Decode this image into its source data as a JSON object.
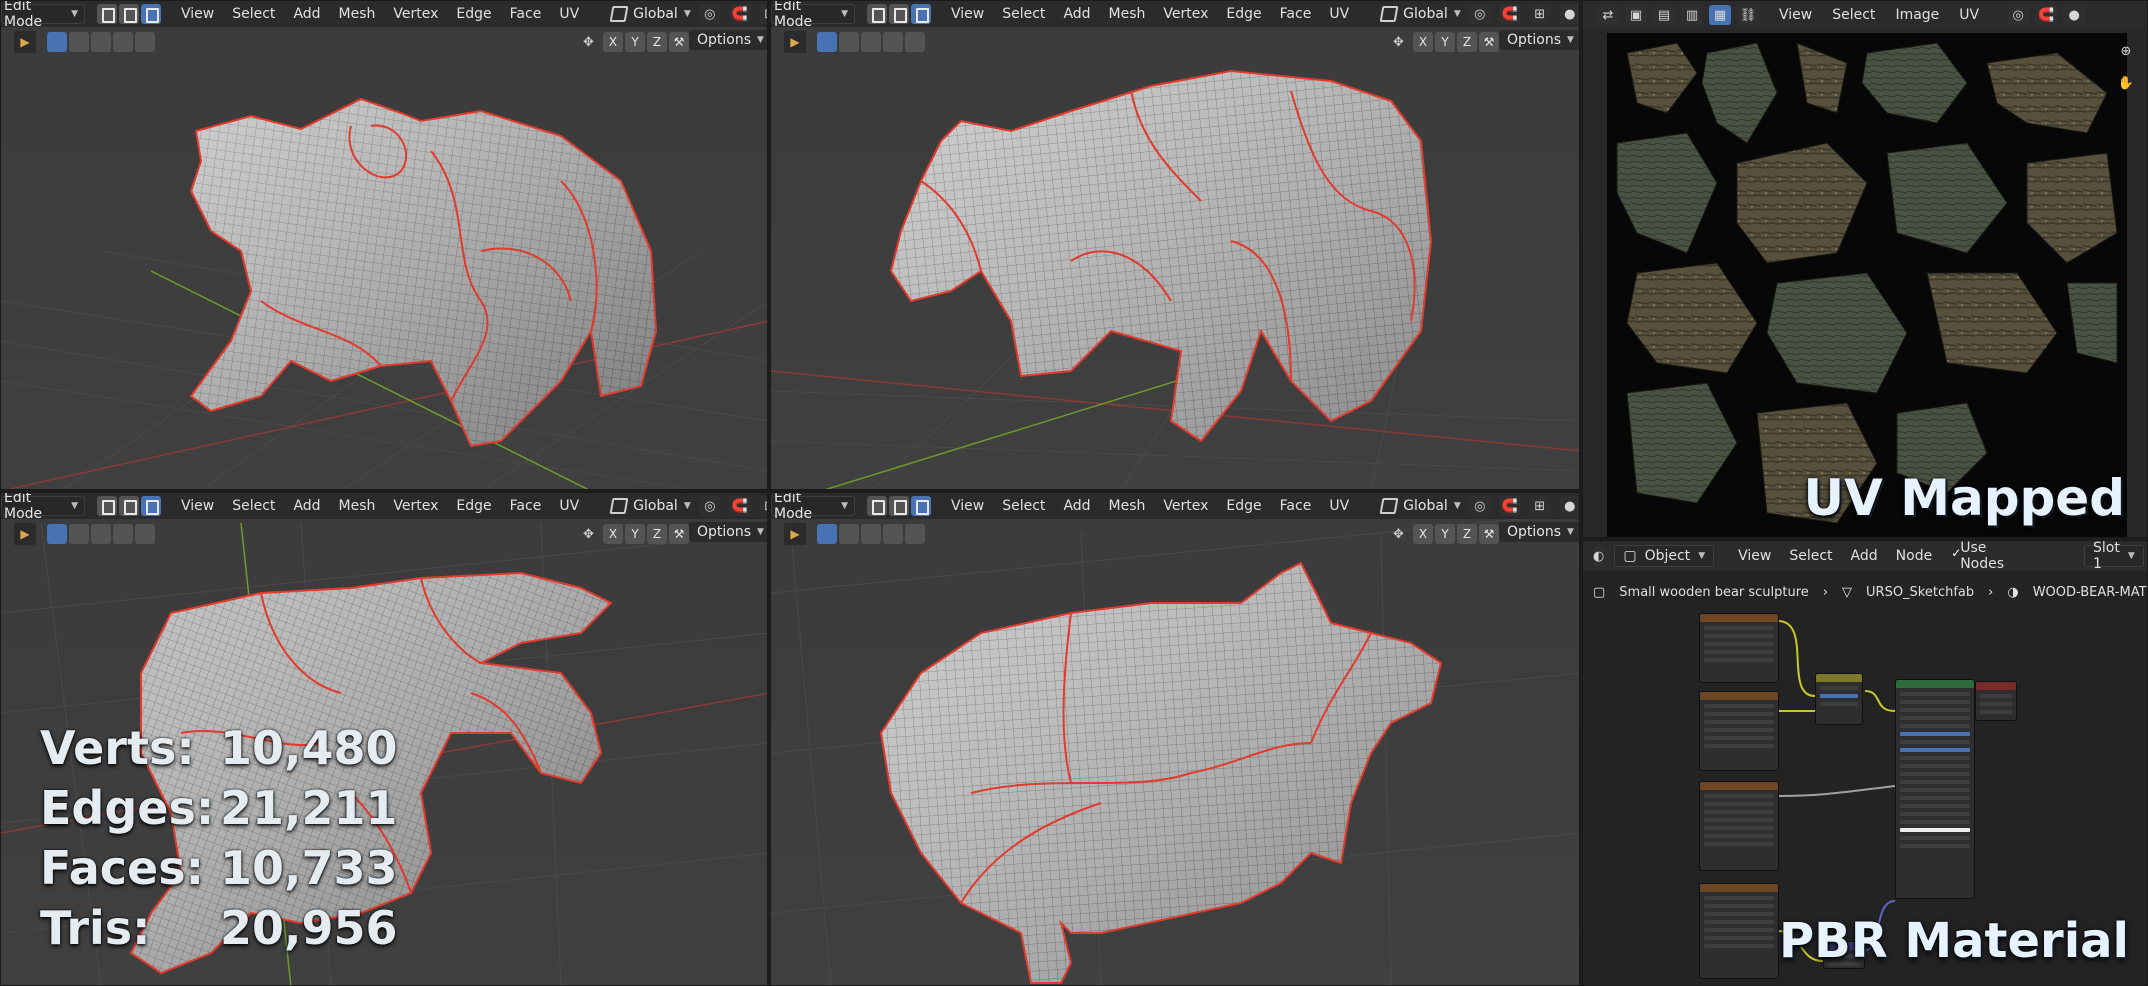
{
  "viewport_header": {
    "mode": "Edit Mode",
    "menu": [
      "View",
      "Select",
      "Add",
      "Mesh",
      "Vertex",
      "Edge",
      "Face",
      "UV"
    ],
    "orientation": "Global",
    "options": "Options",
    "axes": [
      "X",
      "Y",
      "Z"
    ]
  },
  "stats": {
    "verts_label": "Verts:",
    "verts": "10,480",
    "edges_label": "Edges:",
    "edges": "21,211",
    "faces_label": "Faces:",
    "faces": "10,733",
    "tris_label": "Tris:",
    "tris": "20,956"
  },
  "image_editor": {
    "menu": [
      "View",
      "Select",
      "Image",
      "UV"
    ],
    "overlay_title": "UV Mapped"
  },
  "node_editor": {
    "object_type": "Object",
    "menu": [
      "View",
      "Select",
      "Add",
      "Node"
    ],
    "use_nodes_label": "Use Nodes",
    "slot": "Slot 1",
    "breadcrumb": [
      "Small wooden bear sculpture",
      "URSO_Sketchfab",
      "WOOD-BEAR-MAT"
    ],
    "overlay_title": "PBR Material"
  },
  "colors": {
    "seam": "#e23a2c",
    "active_blue": "#4772b3",
    "grid_x": "#b0403a",
    "grid_y": "#6f9a2c"
  }
}
